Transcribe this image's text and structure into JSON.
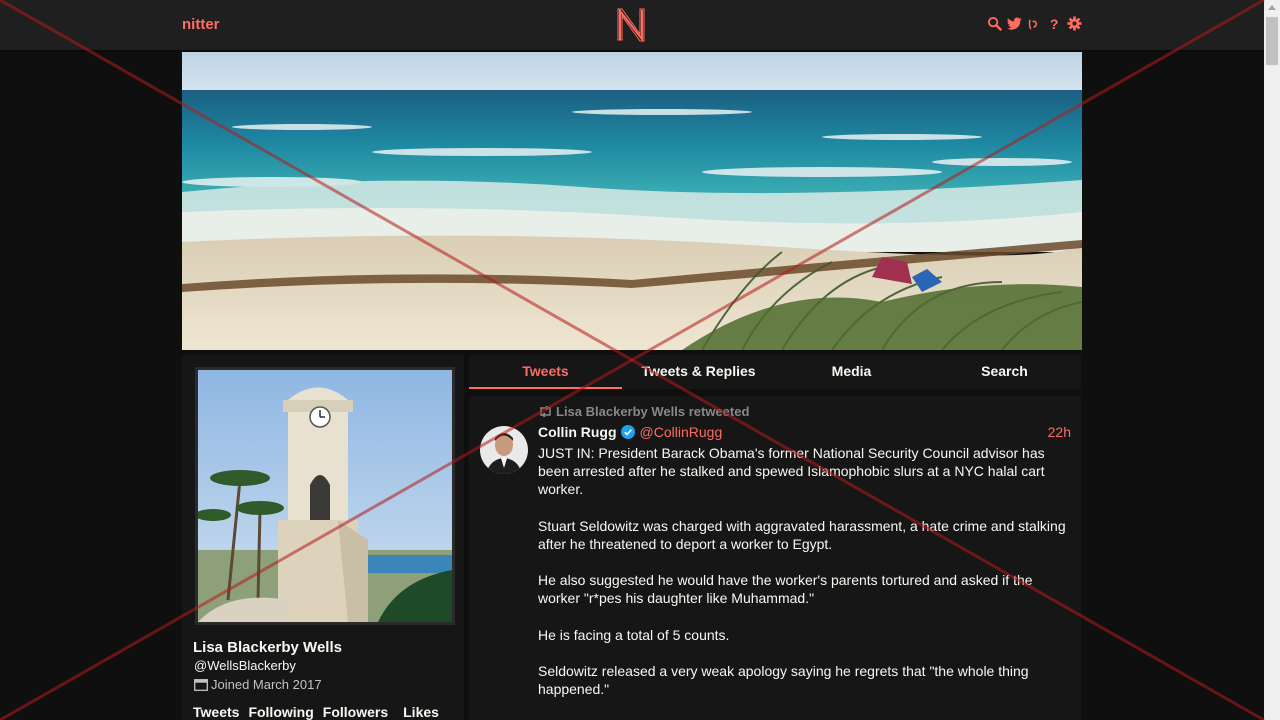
{
  "navbar": {
    "brand": "nitter",
    "icons": [
      "search-icon",
      "bird-icon",
      "rss-icon",
      "help-icon",
      "gear-icon"
    ]
  },
  "colors": {
    "accent": "#ff6c60",
    "background": "#0f0f0f",
    "panel": "#161616",
    "navbar": "#1f1f1f",
    "text": "#f8f8f2",
    "muted": "#888889",
    "verified": "#1da1f2"
  },
  "profile": {
    "fullname": "Lisa Blackerby Wells",
    "username": "@WellsBlackerby",
    "joined": "Joined March 2017",
    "stats": [
      "Tweets",
      "Following",
      "Followers",
      "Likes"
    ]
  },
  "tabs": [
    "Tweets",
    "Tweets & Replies",
    "Media",
    "Search"
  ],
  "active_tab": "Tweets",
  "tweet": {
    "retweet_header": "Lisa Blackerby Wells retweeted",
    "name": "Collin Rugg",
    "handle": "@CollinRugg",
    "date": "22h",
    "paragraphs": [
      "JUST IN: President Barack Obama's former National Security Council advisor has been arrested after he stalked and spewed Islamophobic slurs at a NYC halal cart worker.",
      "Stuart Seldowitz was charged with aggravated harassment, a hate crime and stalking after he threatened to deport a worker to Egypt.",
      "He also suggested he would have the worker's parents tortured and asked if the worker \"r*pes his daughter like Muhammad.\"",
      "He is facing a total of 5 counts.",
      "Seldowitz released a very weak apology saying he regrets that \"the whole thing happened.\""
    ]
  }
}
